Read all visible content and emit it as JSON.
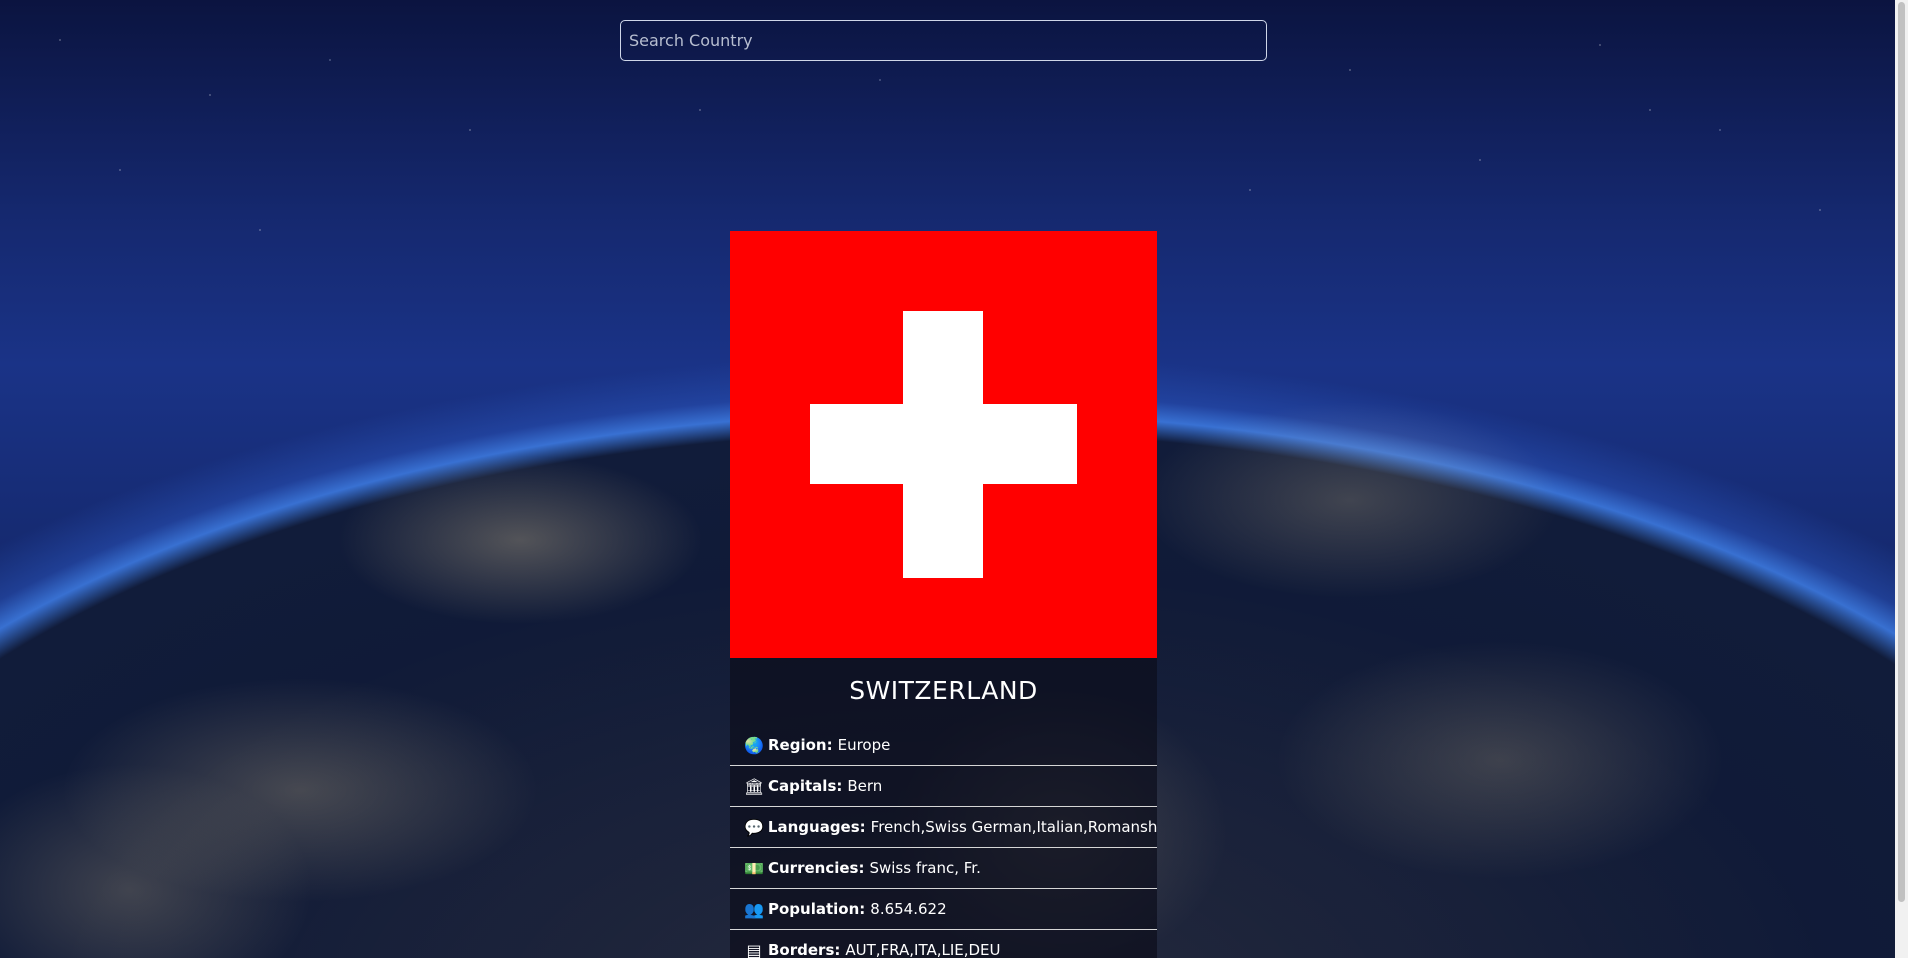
{
  "search": {
    "placeholder": "Search Country",
    "value": ""
  },
  "country": {
    "name": "SWITZERLAND",
    "flag_colors": {
      "background": "#ff0000",
      "cross": "#ffffff"
    }
  },
  "details": [
    {
      "icon": "globe-icon",
      "label": "Region:",
      "value": "Europe"
    },
    {
      "icon": "landmark-icon",
      "label": "Capitals:",
      "value": "Bern"
    },
    {
      "icon": "comments-icon",
      "label": "Languages:",
      "value": "French,Swiss German,Italian,Romansh"
    },
    {
      "icon": "money-bill-icon",
      "label": "Currencies:",
      "value": "Swiss franc, Fr."
    },
    {
      "icon": "people-icon",
      "label": "Population:",
      "value": "8.654.622"
    },
    {
      "icon": "road-barrier-icon",
      "label": "Borders:",
      "value": "AUT,FRA,ITA,LIE,DEU"
    }
  ]
}
